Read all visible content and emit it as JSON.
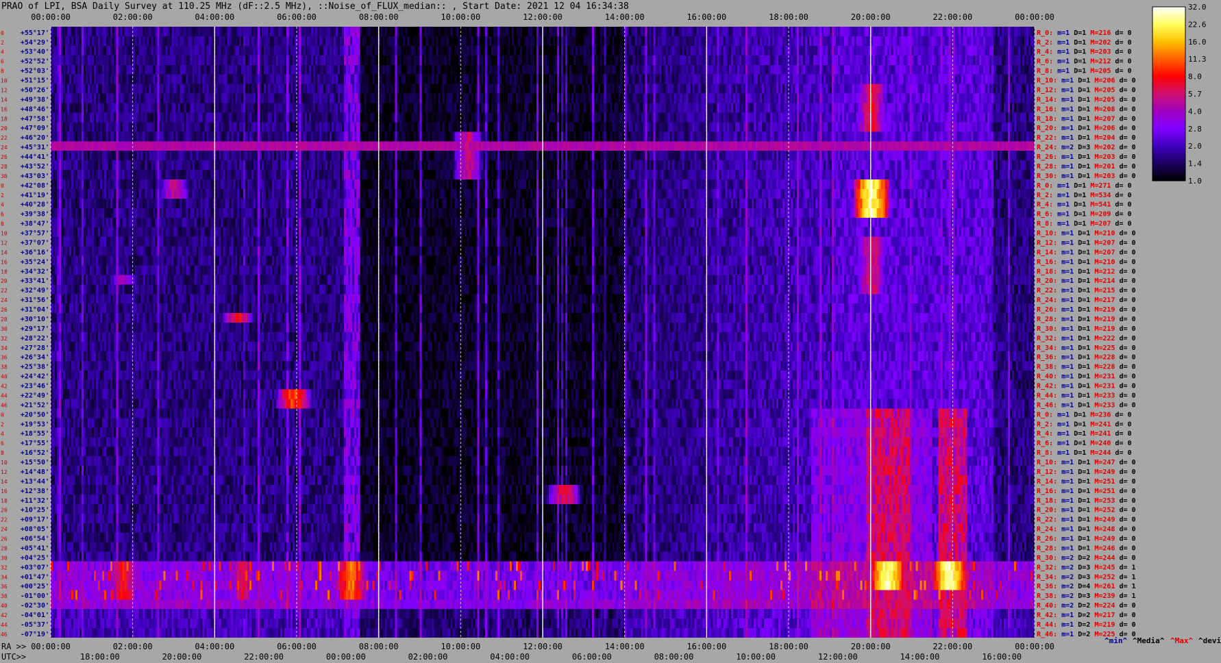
{
  "page": {
    "title": "PRAO of LPI, BSA Daily Survey at 110.25 MHz (dF::2.5 MHz), ::Noise_of_FLUX_median:: , Start Date: 2021 12 04 16:34:38",
    "ra_row_label": "RA >>",
    "utc_row_label": "UTC>>"
  },
  "chart_data": {
    "type": "heatmap",
    "title": "PRAO of LPI, BSA Daily Survey at 110.25 MHz (dF::2.5 MHz), ::Noise_of_FLUX_median:: , Start Date: 2021 12 04 16:34:38",
    "x_top_ticks": [
      "00:00:00",
      "02:00:00",
      "04:00:00",
      "06:00:00",
      "08:00:00",
      "10:00:00",
      "12:00:00",
      "14:00:00",
      "16:00:00",
      "18:00:00",
      "20:00:00",
      "22:00:00",
      "00:00:00"
    ],
    "x_bottom_ra_ticks": [
      "00:00:00",
      "02:00:00",
      "04:00:00",
      "06:00:00",
      "08:00:00",
      "10:00:00",
      "12:00:00",
      "14:00:00",
      "16:00:00",
      "18:00:00",
      "20:00:00",
      "22:00:00",
      "00:00:00"
    ],
    "x_bottom_utc_ticks": [
      "18:00:00",
      "20:00:00",
      "22:00:00",
      "00:00:00",
      "02:00:00",
      "04:00:00",
      "06:00:00",
      "08:00:00",
      "10:00:00",
      "12:00:00",
      "14:00:00",
      "16:00:00"
    ],
    "y_declination_labels": [
      "+55°17'",
      "+54°29'",
      "+53°40'",
      "+52°52'",
      "+52°03'",
      "+51°15'",
      "+50°26'",
      "+49°38'",
      "+48°46'",
      "+47°58'",
      "+47°09'",
      "+46°20'",
      "+45°31'",
      "+44°41'",
      "+43°52'",
      "+43°03'",
      "+42°08'",
      "+41°19'",
      "+40°28'",
      "+39°38'",
      "+38°47'",
      "+37°57'",
      "+37°07'",
      "+36°16'",
      "+35°24'",
      "+34°32'",
      "+33°41'",
      "+32°49'",
      "+31°56'",
      "+31°04'",
      "+30°10'",
      "+29°17'",
      "+28°22'",
      "+27°28'",
      "+26°34'",
      "+25°38'",
      "+24°42'",
      "+23°46'",
      "+22°49'",
      "+21°52'",
      "+20°50'",
      "+19°53'",
      "+18°55'",
      "+17°55'",
      "+16°52'",
      "+15°50'",
      "+14°48'",
      "+13°44'",
      "+12°38'",
      "+11°32'",
      "+10°25'",
      "+09°17'",
      "+08°05'",
      "+06°54'",
      "+05°41'",
      "+04°25'",
      "+03°07'",
      "+01°47'",
      "+00°25'",
      "-01°00'",
      "-02°30'",
      "-04°01'",
      "-05°37'",
      "-07°19'"
    ],
    "y_row_index_labels": [
      "0",
      "2",
      "4",
      "6",
      "8",
      "10",
      "12",
      "14",
      "16",
      "18",
      "20",
      "22",
      "24",
      "26",
      "28",
      "30",
      "0",
      "2",
      "4",
      "6",
      "8",
      "10",
      "12",
      "14",
      "16",
      "18",
      "20",
      "22",
      "24",
      "26",
      "28",
      "30",
      "32",
      "34",
      "36",
      "38",
      "40",
      "42",
      "44",
      "46",
      "0",
      "2",
      "4",
      "6",
      "8",
      "10",
      "12",
      "14",
      "16",
      "18",
      "20",
      "22",
      "24",
      "26",
      "28",
      "30",
      "32",
      "34",
      "36",
      "38",
      "40",
      "42",
      "44",
      "46"
    ],
    "row_stats": [
      [
        "R_0:",
        "m=1",
        "D=1",
        "M=216",
        "d= 0"
      ],
      [
        "R_2:",
        "m=1",
        "D=1",
        "M=202",
        "d= 0"
      ],
      [
        "R_4:",
        "m=1",
        "D=1",
        "M=203",
        "d= 0"
      ],
      [
        "R_6:",
        "m=1",
        "D=1",
        "M=212",
        "d= 0"
      ],
      [
        "R_8:",
        "m=1",
        "D=1",
        "M=205",
        "d= 0"
      ],
      [
        "R_10:",
        "m=1",
        "D=1",
        "M=206",
        "d= 0"
      ],
      [
        "R_12:",
        "m=1",
        "D=1",
        "M=205",
        "d= 0"
      ],
      [
        "R_14:",
        "m=1",
        "D=1",
        "M=205",
        "d= 0"
      ],
      [
        "R_16:",
        "m=1",
        "D=1",
        "M=208",
        "d= 0"
      ],
      [
        "R_18:",
        "m=1",
        "D=1",
        "M=207",
        "d= 0"
      ],
      [
        "R_20:",
        "m=1",
        "D=1",
        "M=206",
        "d= 0"
      ],
      [
        "R_22:",
        "m=1",
        "D=1",
        "M=204",
        "d= 0"
      ],
      [
        "R_24:",
        "m=2",
        "D=3",
        "M=202",
        "d= 0"
      ],
      [
        "R_26:",
        "m=1",
        "D=1",
        "M=203",
        "d= 0"
      ],
      [
        "R_28:",
        "m=1",
        "D=1",
        "M=201",
        "d= 0"
      ],
      [
        "R_30:",
        "m=1",
        "D=1",
        "M=203",
        "d= 0"
      ],
      [
        "R_0:",
        "m=1",
        "D=1",
        "M=271",
        "d= 0"
      ],
      [
        "R_2:",
        "m=1",
        "D=1",
        "M=534",
        "d= 0"
      ],
      [
        "R_4:",
        "m=1",
        "D=1",
        "M=541",
        "d= 0"
      ],
      [
        "R_6:",
        "m=1",
        "D=1",
        "M=209",
        "d= 0"
      ],
      [
        "R_8:",
        "m=1",
        "D=1",
        "M=207",
        "d= 0"
      ],
      [
        "R_10:",
        "m=1",
        "D=1",
        "M=210",
        "d= 0"
      ],
      [
        "R_12:",
        "m=1",
        "D=1",
        "M=207",
        "d= 0"
      ],
      [
        "R_14:",
        "m=1",
        "D=1",
        "M=207",
        "d= 0"
      ],
      [
        "R_16:",
        "m=1",
        "D=1",
        "M=210",
        "d= 0"
      ],
      [
        "R_18:",
        "m=1",
        "D=1",
        "M=212",
        "d= 0"
      ],
      [
        "R_20:",
        "m=1",
        "D=1",
        "M=214",
        "d= 0"
      ],
      [
        "R_22:",
        "m=1",
        "D=1",
        "M=215",
        "d= 0"
      ],
      [
        "R_24:",
        "m=1",
        "D=1",
        "M=217",
        "d= 0"
      ],
      [
        "R_26:",
        "m=1",
        "D=1",
        "M=219",
        "d= 0"
      ],
      [
        "R_28:",
        "m=1",
        "D=1",
        "M=219",
        "d= 0"
      ],
      [
        "R_30:",
        "m=1",
        "D=1",
        "M=219",
        "d= 0"
      ],
      [
        "R_32:",
        "m=1",
        "D=1",
        "M=222",
        "d= 0"
      ],
      [
        "R_34:",
        "m=1",
        "D=1",
        "M=225",
        "d= 0"
      ],
      [
        "R_36:",
        "m=1",
        "D=1",
        "M=228",
        "d= 0"
      ],
      [
        "R_38:",
        "m=1",
        "D=1",
        "M=228",
        "d= 0"
      ],
      [
        "R_40:",
        "m=1",
        "D=1",
        "M=231",
        "d= 0"
      ],
      [
        "R_42:",
        "m=1",
        "D=1",
        "M=231",
        "d= 0"
      ],
      [
        "R_44:",
        "m=1",
        "D=1",
        "M=233",
        "d= 0"
      ],
      [
        "R_46:",
        "m=1",
        "D=1",
        "M=233",
        "d= 0"
      ],
      [
        "R_0:",
        "m=1",
        "D=1",
        "M=236",
        "d= 0"
      ],
      [
        "R_2:",
        "m=1",
        "D=1",
        "M=241",
        "d= 0"
      ],
      [
        "R_4:",
        "m=1",
        "D=1",
        "M=241",
        "d= 0"
      ],
      [
        "R_6:",
        "m=1",
        "D=1",
        "M=240",
        "d= 0"
      ],
      [
        "R_8:",
        "m=1",
        "D=1",
        "M=244",
        "d= 0"
      ],
      [
        "R_10:",
        "m=1",
        "D=1",
        "M=247",
        "d= 0"
      ],
      [
        "R_12:",
        "m=1",
        "D=1",
        "M=249",
        "d= 0"
      ],
      [
        "R_14:",
        "m=1",
        "D=1",
        "M=251",
        "d= 0"
      ],
      [
        "R_16:",
        "m=1",
        "D=1",
        "M=251",
        "d= 0"
      ],
      [
        "R_18:",
        "m=1",
        "D=1",
        "M=253",
        "d= 0"
      ],
      [
        "R_20:",
        "m=1",
        "D=1",
        "M=252",
        "d= 0"
      ],
      [
        "R_22:",
        "m=1",
        "D=1",
        "M=249",
        "d= 0"
      ],
      [
        "R_24:",
        "m=1",
        "D=1",
        "M=248",
        "d= 0"
      ],
      [
        "R_26:",
        "m=1",
        "D=1",
        "M=249",
        "d= 0"
      ],
      [
        "R_28:",
        "m=1",
        "D=1",
        "M=246",
        "d= 0"
      ],
      [
        "R_30:",
        "m=2",
        "D=2",
        "M=244",
        "d= 0"
      ],
      [
        "R_32:",
        "m=2",
        "D=3",
        "M=245",
        "d= 1"
      ],
      [
        "R_34:",
        "m=2",
        "D=3",
        "M=252",
        "d= 1"
      ],
      [
        "R_36:",
        "m=2",
        "D=4",
        "M=261",
        "d= 1"
      ],
      [
        "R_38:",
        "m=2",
        "D=3",
        "M=239",
        "d= 1"
      ],
      [
        "R_40:",
        "m=2",
        "D=2",
        "M=224",
        "d= 0"
      ],
      [
        "R_42:",
        "m=1",
        "D=2",
        "M=217",
        "d= 0"
      ],
      [
        "R_44:",
        "m=1",
        "D=2",
        "M=219",
        "d= 0"
      ],
      [
        "R_46:",
        "m=1",
        "D=2",
        "M=225",
        "d= 0"
      ]
    ],
    "colorbar": {
      "labels": [
        "32.0",
        "22.6",
        "16.0",
        "11.3",
        "8.0",
        "5.7",
        "4.0",
        "2.8",
        "2.0",
        "1.4",
        "1.0"
      ],
      "colors": [
        "#ffffff",
        "#ffff60",
        "#ffc000",
        "#ff6000",
        "#ff0000",
        "#d01070",
        "#a000c0",
        "#8000ff",
        "#4000c0",
        "#1a0060",
        "#000000"
      ]
    },
    "legend": [
      {
        "label": "^min^",
        "color": "#00008b"
      },
      {
        "label": "^Media^",
        "color": "#000000"
      },
      {
        "label": "^Max^",
        "color": "#e00000"
      },
      {
        "label": "^devia^",
        "color": "#000000"
      }
    ],
    "features": [
      {
        "type": "row_band",
        "row": 12,
        "level": 4.5
      },
      {
        "type": "bright_column_band",
        "ra_start": "19:55",
        "ra_end": "20:55",
        "row_from": 40,
        "row_to": 63,
        "level": 7
      },
      {
        "type": "bright_column_band",
        "ra_start": "21:40",
        "ra_end": "22:20",
        "row_from": 40,
        "row_to": 63,
        "level": 7
      },
      {
        "type": "bright_column_band",
        "ra_start": "07:10",
        "ra_end": "07:30",
        "row_from": 0,
        "row_to": 63,
        "level": 3.5
      },
      {
        "type": "blob",
        "ra": "20:00",
        "row_from": 16,
        "row_to": 19,
        "level": 28
      },
      {
        "type": "blob",
        "ra": "20:25",
        "row_from": 56,
        "row_to": 58,
        "level": 30
      },
      {
        "type": "blob",
        "ra": "21:55",
        "row_from": 56,
        "row_to": 58,
        "level": 30
      },
      {
        "type": "blob",
        "ra": "07:20",
        "row_from": 56,
        "row_to": 59,
        "level": 14
      },
      {
        "type": "blob",
        "ra": "01:45",
        "row_from": 56,
        "row_to": 59,
        "level": 9
      },
      {
        "type": "blob",
        "ra": "04:40",
        "row_from": 56,
        "row_to": 59,
        "level": 7
      },
      {
        "type": "blob",
        "ra": "03:00",
        "row_from": 16,
        "row_to": 17,
        "level": 6
      },
      {
        "type": "blob",
        "ra": "04:35",
        "row_from": 30,
        "row_to": 30,
        "level": 9
      },
      {
        "type": "blob",
        "ra": "05:55",
        "row_from": 38,
        "row_to": 39,
        "level": 12
      },
      {
        "type": "blob",
        "ra": "12:30",
        "row_from": 48,
        "row_to": 49,
        "level": 8
      },
      {
        "type": "blob",
        "ra": "01:45",
        "row_from": 26,
        "row_to": 26,
        "level": 5
      },
      {
        "type": "blob",
        "ra": "20:00",
        "row_from": 6,
        "row_to": 10,
        "level": 8
      },
      {
        "type": "blob",
        "ra": "20:00",
        "row_from": 22,
        "row_to": 27,
        "level": 7
      },
      {
        "type": "blob",
        "ra": "10:10",
        "row_from": 11,
        "row_to": 15,
        "level": 6
      }
    ]
  }
}
